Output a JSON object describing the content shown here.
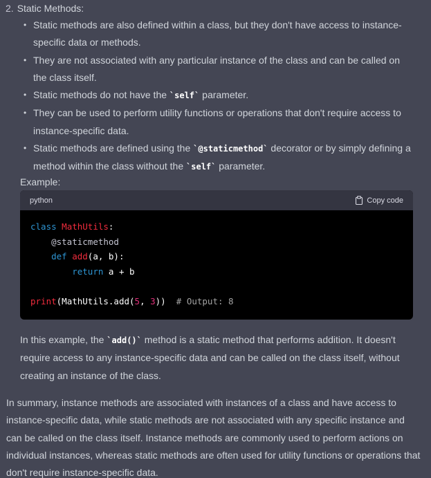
{
  "section": {
    "number": "2.",
    "title": "Static Methods:"
  },
  "bullets": [
    {
      "parts": [
        "Static methods are also defined within a class, but they don't have access to instance-specific data or methods."
      ]
    },
    {
      "parts": [
        "They are not associated with any particular instance of the class and can be called on the class itself."
      ]
    },
    {
      "parts": [
        "Static methods do not have the ",
        "`self`",
        " parameter."
      ]
    },
    {
      "parts": [
        "They can be used to perform utility functions or operations that don't require access to instance-specific data."
      ]
    },
    {
      "parts": [
        "Static methods are defined using the ",
        "`@staticmethod`",
        " decorator or by simply defining a method within the class without the ",
        "`self`",
        " parameter."
      ]
    }
  ],
  "example_label": "Example:",
  "code_block": {
    "language": "python",
    "copy_label": "Copy code",
    "lines": [
      [
        {
          "t": "class",
          "c": "kw"
        },
        {
          "t": " "
        },
        {
          "t": "MathUtils",
          "c": "cls"
        },
        {
          "t": ":"
        }
      ],
      [
        {
          "t": "    "
        },
        {
          "t": "@staticmethod",
          "c": "dec"
        }
      ],
      [
        {
          "t": "    "
        },
        {
          "t": "def",
          "c": "kw"
        },
        {
          "t": " "
        },
        {
          "t": "add",
          "c": "fn"
        },
        {
          "t": "(a, b):"
        }
      ],
      [
        {
          "t": "        "
        },
        {
          "t": "return",
          "c": "kw"
        },
        {
          "t": " a + b"
        }
      ],
      [],
      [
        {
          "t": "print",
          "c": "fn"
        },
        {
          "t": "(MathUtils.add("
        },
        {
          "t": "5",
          "c": "num"
        },
        {
          "t": ", "
        },
        {
          "t": "3",
          "c": "num"
        },
        {
          "t": "))  "
        },
        {
          "t": "# Output: 8",
          "c": "cmt"
        }
      ]
    ]
  },
  "paragraph1": {
    "parts": [
      "In this example, the ",
      "`add()`",
      " method is a static method that performs addition. It doesn't require access to any instance-specific data and can be called on the class itself, without creating an instance of the class."
    ]
  },
  "paragraph2": "In summary, instance methods are associated with instances of a class and have access to instance-specific data, while static methods are not associated with any specific instance and can be called on the class itself. Instance methods are commonly used to perform actions on individual instances, whereas static methods are often used for utility functions or operations that don't require instance-specific data.",
  "colors": {
    "background": "#444654",
    "code_background": "#000000",
    "code_header": "#343541",
    "keyword": "#2e95d3",
    "name": "#f22c3d",
    "number": "#df3079"
  },
  "icons": {
    "copy": "clipboard-icon"
  }
}
